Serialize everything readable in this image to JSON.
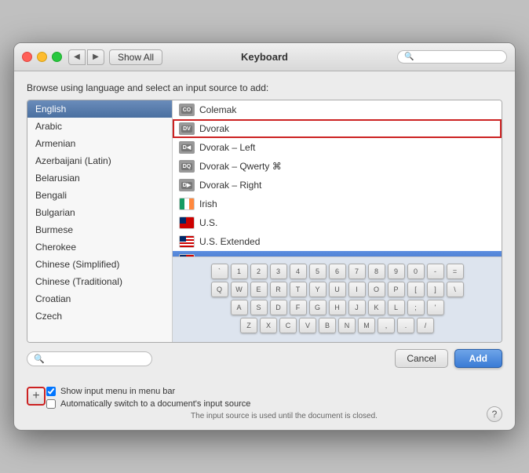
{
  "window": {
    "title": "Keyboard"
  },
  "titlebar": {
    "show_all": "Show All",
    "back_icon": "◀",
    "forward_icon": "▶"
  },
  "dialog": {
    "browse_label": "Browse using language and select an input source to add:"
  },
  "languages": [
    {
      "id": "english",
      "label": "English",
      "selected": true
    },
    {
      "id": "arabic",
      "label": "Arabic"
    },
    {
      "id": "armenian",
      "label": "Armenian"
    },
    {
      "id": "azerbaijani",
      "label": "Azerbaijani (Latin)"
    },
    {
      "id": "belarusian",
      "label": "Belarusian"
    },
    {
      "id": "bengali",
      "label": "Bengali"
    },
    {
      "id": "bulgarian",
      "label": "Bulgarian"
    },
    {
      "id": "burmese",
      "label": "Burmese"
    },
    {
      "id": "cherokee",
      "label": "Cherokee"
    },
    {
      "id": "chinese_simplified",
      "label": "Chinese (Simplified)"
    },
    {
      "id": "chinese_traditional",
      "label": "Chinese (Traditional)"
    },
    {
      "id": "croatian",
      "label": "Croatian"
    },
    {
      "id": "czech",
      "label": "Czech"
    }
  ],
  "input_sources": [
    {
      "id": "colemak",
      "label": "Colemak",
      "icon_type": "dv",
      "icon_text": "CO"
    },
    {
      "id": "dvorak",
      "label": "Dvorak",
      "icon_type": "dv",
      "icon_text": "DV",
      "highlighted": true
    },
    {
      "id": "dvorak_left",
      "label": "Dvorak – Left",
      "icon_type": "dv",
      "icon_text": "DL"
    },
    {
      "id": "dvorak_qwerty",
      "label": "Dvorak – Qwerty ⌘",
      "icon_type": "dv",
      "icon_text": "DQ"
    },
    {
      "id": "dvorak_right",
      "label": "Dvorak – Right",
      "icon_type": "dv",
      "icon_text": "DR"
    },
    {
      "id": "irish",
      "label": "Irish",
      "icon_type": "flag_ie"
    },
    {
      "id": "us",
      "label": "U.S.",
      "icon_type": "flag_us"
    },
    {
      "id": "us_extended",
      "label": "U.S. Extended",
      "icon_type": "flag_us_ext"
    },
    {
      "id": "us_international_pc",
      "label": "U.S. International – PC",
      "icon_type": "flag_us_int",
      "selected": true
    }
  ],
  "keyboard": {
    "rows": [
      [
        "`",
        "1",
        "2",
        "3",
        "4",
        "5",
        "6",
        "7",
        "8",
        "9",
        "0",
        "-",
        "="
      ],
      [
        "Q",
        "W",
        "E",
        "R",
        "T",
        "Y",
        "U",
        "I",
        "O",
        "P",
        "[",
        "]",
        "\\"
      ],
      [
        "A",
        "S",
        "D",
        "F",
        "G",
        "H",
        "J",
        "K",
        "L",
        ";",
        "'"
      ],
      [
        "Z",
        "X",
        "C",
        "V",
        "B",
        "N",
        "M",
        ",",
        ".",
        "/"
      ]
    ]
  },
  "bottom_bar": {
    "cancel_label": "Cancel",
    "add_label": "Add"
  },
  "footer": {
    "show_input_menu": "Show input menu in menu bar",
    "auto_switch_label": "Automatically switch to a document's input source",
    "footnote": "The input source is used until the document is closed.",
    "plus_label": "+"
  }
}
